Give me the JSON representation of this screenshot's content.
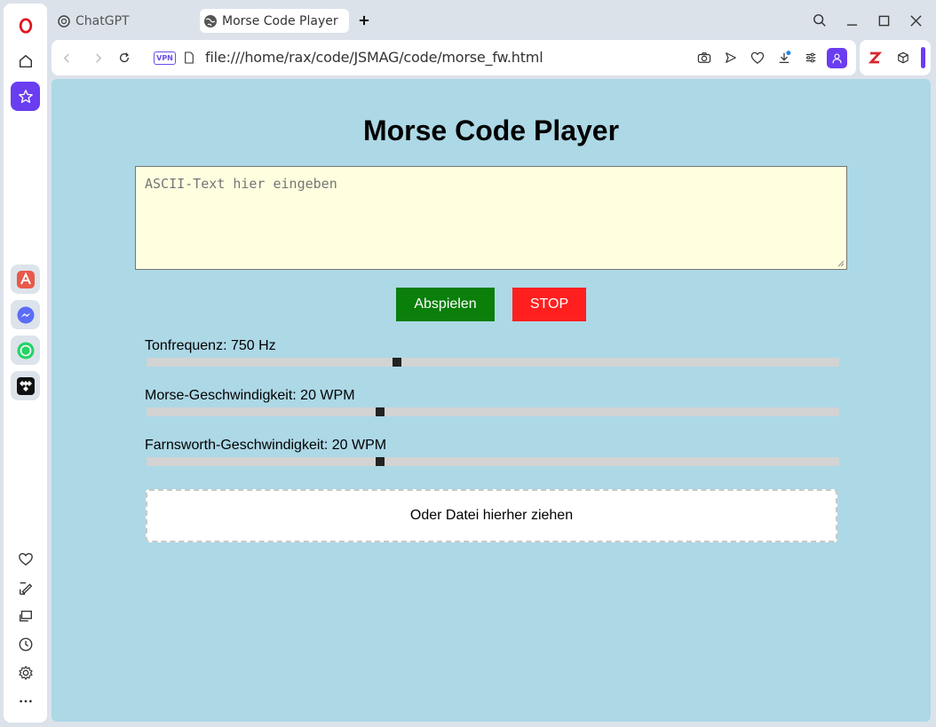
{
  "tabs": [
    {
      "label": "ChatGPT"
    },
    {
      "label": "Morse Code Player"
    }
  ],
  "address": {
    "vpn_label": "VPN",
    "url": "file:///home/rax/code/JSMAG/code/morse_fw.html"
  },
  "page": {
    "title": "Morse Code Player",
    "textarea_placeholder": "ASCII-Text hier eingeben",
    "play_label": "Abspielen",
    "stop_label": "STOP",
    "sliders": [
      {
        "label": "Tonfrequenz: 750 Hz",
        "value_fraction": 0.36
      },
      {
        "label": "Morse-Geschwindigkeit: 20 WPM",
        "value_fraction": 0.335
      },
      {
        "label": "Farnsworth-Geschwindigkeit: 20 WPM",
        "value_fraction": 0.335
      }
    ],
    "dropzone_label": "Oder Datei hierher ziehen"
  },
  "colors": {
    "page_background": "#add8e6",
    "textarea_background": "#ffffe0",
    "play_button": "#0a7f0a",
    "stop_button": "#ff1f1f",
    "sidebar_accent": "#6a3df0"
  },
  "icons": {
    "sidebar": [
      "opera-logo-icon",
      "home-icon",
      "pinboard-icon",
      "aria-icon",
      "messenger-icon",
      "whatsapp-icon",
      "tidal-icon",
      "heart-icon",
      "edit-icon",
      "snapshot-icon",
      "history-icon",
      "settings-icon",
      "more-icon"
    ],
    "toolbar": [
      "camera-icon",
      "send-icon",
      "heart-icon",
      "download-icon",
      "easy-setup-icon",
      "profile-icon"
    ]
  }
}
